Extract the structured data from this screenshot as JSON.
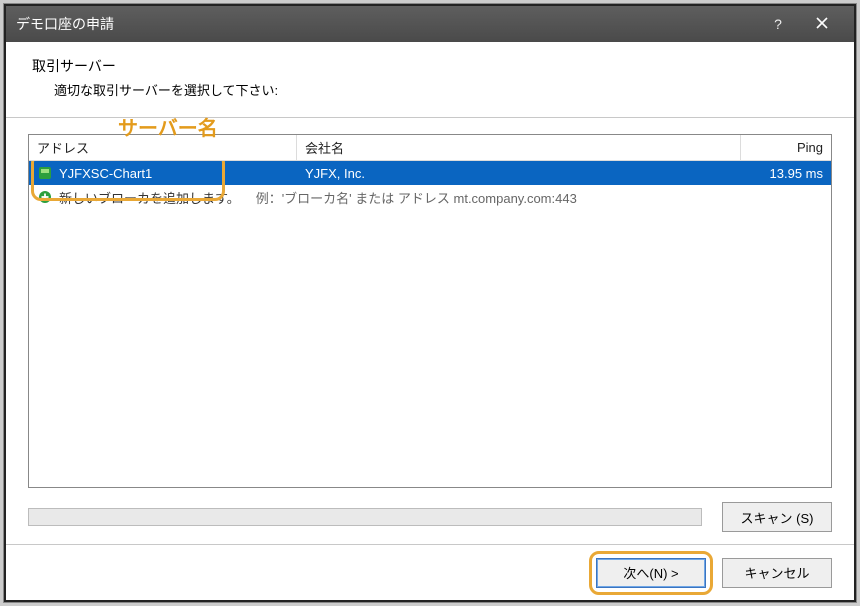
{
  "window": {
    "title": "デモ口座の申請"
  },
  "header": {
    "title": "取引サーバー",
    "subtitle": "適切な取引サーバーを選択して下さい:"
  },
  "columns": {
    "address": "アドレス",
    "company": "会社名",
    "ping": "Ping"
  },
  "rows": [
    {
      "address": "YJFXSC-Chart1",
      "company": "YJFX, Inc.",
      "ping": "13.95 ms",
      "selected": true
    }
  ],
  "add_row": {
    "label": "新しいブローカを追加します。",
    "example": "例：'ブローカ名' または アドレス mt.company.com:443"
  },
  "buttons": {
    "scan": "スキャン (S)",
    "next": "次へ(N) >",
    "cancel": "キャンセル"
  },
  "annotations": {
    "server_name": "サーバー名"
  }
}
